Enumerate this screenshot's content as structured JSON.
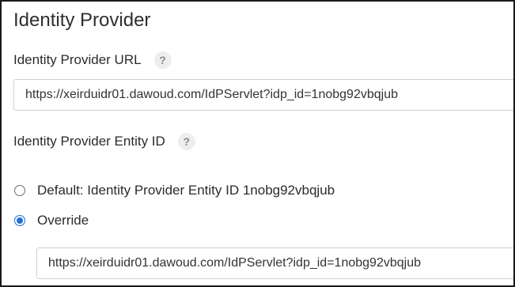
{
  "section": {
    "title": "Identity Provider"
  },
  "idp_url": {
    "label": "Identity Provider URL",
    "help_glyph": "?",
    "value": "https://xeirduidr01.dawoud.com/IdPServlet?idp_id=1nobg92vbqjub"
  },
  "entity_id": {
    "label": "Identity Provider Entity ID",
    "help_glyph": "?",
    "options": [
      {
        "label": "Default: Identity Provider Entity ID 1nobg92vbqjub",
        "checked": false
      },
      {
        "label": "Override",
        "checked": true
      }
    ],
    "override_value": "https://xeirduidr01.dawoud.com/IdPServlet?idp_id=1nobg92vbqjub"
  },
  "colors": {
    "accent": "#1f6fd6",
    "border": "#cfcfcf",
    "help_bg": "#eeeeee"
  }
}
